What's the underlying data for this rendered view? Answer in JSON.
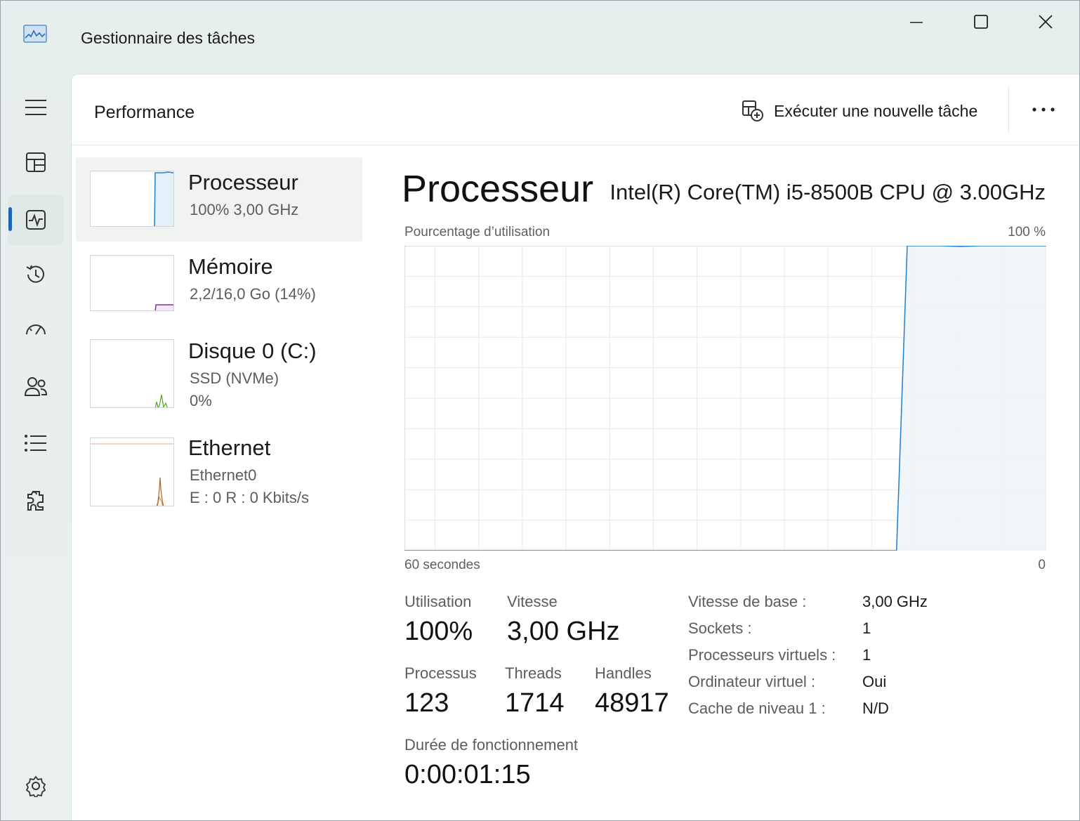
{
  "window": {
    "title": "Gestionnaire des tâches",
    "icon": "task-manager-icon"
  },
  "nav": [
    {
      "name": "hamburger-menu-icon"
    },
    {
      "name": "processes-icon"
    },
    {
      "name": "performance-icon",
      "active": true
    },
    {
      "name": "app-history-icon"
    },
    {
      "name": "startup-apps-icon"
    },
    {
      "name": "users-icon"
    },
    {
      "name": "details-icon"
    },
    {
      "name": "services-icon"
    },
    {
      "name": "settings-icon"
    }
  ],
  "header": {
    "title": "Performance",
    "run_task_label": "Exécuter une nouvelle tâche"
  },
  "side_list": [
    {
      "name": "Processeur",
      "sub1": "100%  3,00 GHz",
      "sub2": "",
      "color": "#1f7fd0",
      "selected": true
    },
    {
      "name": "Mémoire",
      "sub1": "2,2/16,0 Go (14%)",
      "sub2": "",
      "color": "#8b2aa8",
      "selected": false
    },
    {
      "name": "Disque 0 (C:)",
      "sub1": "SSD (NVMe)",
      "sub2": "0%",
      "color": "#4fa62a",
      "selected": false
    },
    {
      "name": "Ethernet",
      "sub1": "Ethernet0",
      "sub2": "E : 0  R : 0 Kbits/s",
      "color": "#b3642a",
      "selected": false
    }
  ],
  "main": {
    "title": "Processeur",
    "model": "Intel(R) Core(TM) i5-8500B CPU @ 3.00GHz",
    "chart_top_left": "Pourcentage d’utilisation",
    "chart_top_right": "100 %",
    "chart_bottom_left": "60 secondes",
    "chart_bottom_right": "0",
    "stats": {
      "utilisation_label": "Utilisation",
      "utilisation_value": "100%",
      "vitesse_label": "Vitesse",
      "vitesse_value": "3,00 GHz",
      "processus_label": "Processus",
      "processus_value": "123",
      "threads_label": "Threads",
      "threads_value": "1714",
      "handles_label": "Handles",
      "handles_value": "48917",
      "uptime_label": "Durée de fonctionnement",
      "uptime_value": "0:00:01:15"
    },
    "details": [
      {
        "key": "Vitesse de base :",
        "value": "3,00 GHz"
      },
      {
        "key": "Sockets :",
        "value": "1"
      },
      {
        "key": "Processeurs virtuels :",
        "value": "1"
      },
      {
        "key": "Ordinateur virtuel :",
        "value": "Oui"
      },
      {
        "key": "Cache de niveau 1 :",
        "value": "N/D"
      }
    ]
  },
  "colors": {
    "accent": "#1f63b8",
    "cpu_line": "#1f7fd0",
    "cpu_fill": "#eef4f9",
    "grid": "#e6e9ea"
  },
  "chart_data": {
    "type": "area",
    "title": "",
    "xlabel": "",
    "ylabel": "Pourcentage d’utilisation",
    "xlim": [
      60,
      0
    ],
    "ylim": [
      0,
      100
    ],
    "x": [
      60,
      14,
      13,
      12,
      10,
      8,
      6,
      4,
      2,
      0
    ],
    "series": [
      {
        "values": [
          0,
          0,
          100,
          100,
          100,
          99.8,
          100,
          100,
          100,
          100
        ]
      }
    ]
  }
}
